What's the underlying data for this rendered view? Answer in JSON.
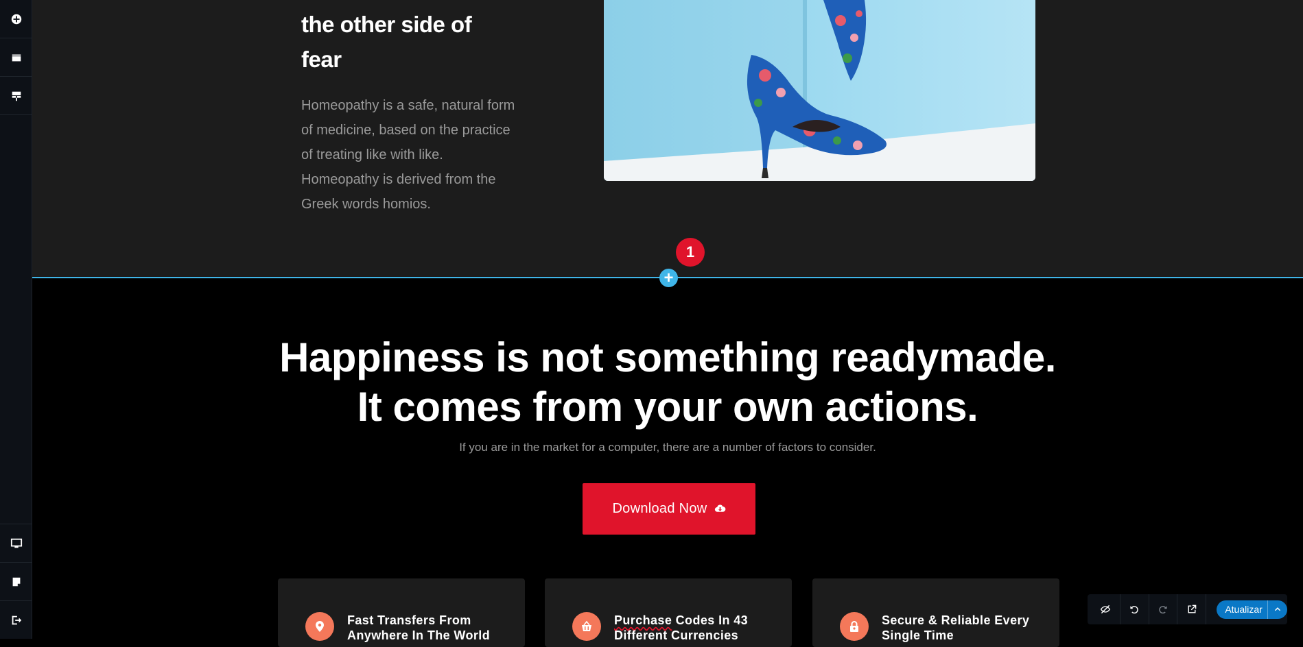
{
  "left_toolbar": {
    "top_items": [
      "add-element",
      "sections",
      "page-templates"
    ],
    "bottom_items": [
      "desktop-preview",
      "page-settings",
      "exit"
    ]
  },
  "top_section": {
    "heading_lines": [
      "the other side of",
      "fear"
    ],
    "paragraph": "Homeopathy is a safe, natural form of medicine, based on the practice of treating like with like. Homeopathy is derived from the Greek words homios.",
    "badge": "1",
    "image_alt": "floral high heel shoes"
  },
  "divider": {
    "add_symbol": "+"
  },
  "hero": {
    "title_line1": "Happiness is not something readymade.",
    "title_line2": "It comes from your own actions.",
    "subtitle": "If you are in the market for a computer, there are a number of factors to consider.",
    "button_label": "Download Now"
  },
  "features": [
    {
      "icon": "map-pin-icon",
      "line1": "Fast Transfers From",
      "line2": "Anywhere In The World"
    },
    {
      "icon": "basket-icon",
      "line1_word1": "Purchase",
      "line1_rest": " Codes In 43",
      "line2": "Different Currencies"
    },
    {
      "icon": "lock-icon",
      "line1": "Secure & Reliable Every",
      "line2": "Single Time"
    }
  ],
  "float_toolbar": {
    "update_label": "Atualizar"
  },
  "colors": {
    "accent_red": "#e0142b",
    "accent_blue": "#3fb5e8",
    "icon_orange": "#f4785a",
    "update_blue": "#0a78c6"
  }
}
